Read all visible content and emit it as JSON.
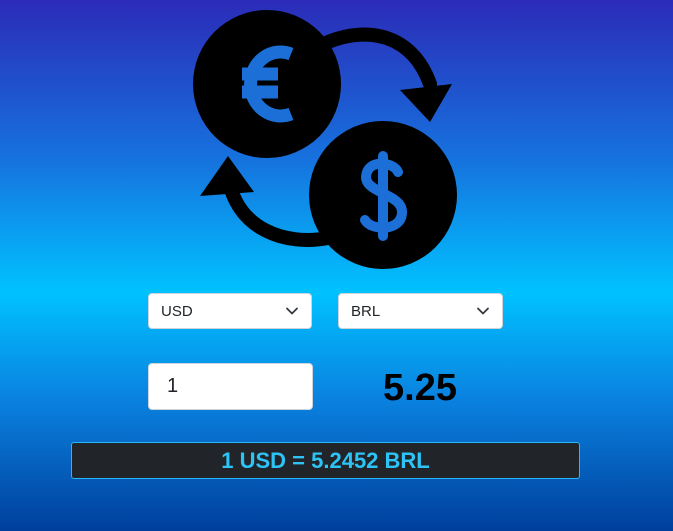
{
  "converter": {
    "from_currency": "USD",
    "to_currency": "BRL",
    "amount": "1",
    "result": "5.25",
    "rate_text": "1 USD = 5.2452 BRL"
  },
  "icons": {
    "logo": "currency-exchange-icon",
    "dropdown": "chevron-down-icon"
  },
  "colors": {
    "rate_text": "#2dc3f5",
    "rate_bar_bg": "#212529",
    "coin_symbol": "#1b6fd6",
    "coin": "#000000"
  }
}
